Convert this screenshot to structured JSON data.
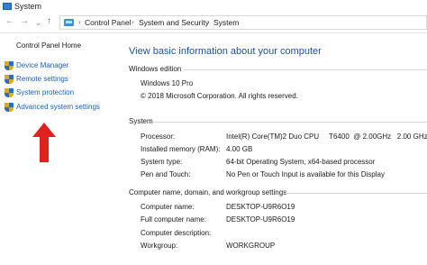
{
  "window": {
    "title": "System"
  },
  "nav": {
    "back_icon": "arrow-left-icon",
    "forward_icon": "arrow-right-icon",
    "up_icon": "arrow-up-icon"
  },
  "breadcrumb": [
    "Control Panel",
    "System and Security",
    "System"
  ],
  "sidebar": {
    "home_label": "Control Panel Home",
    "links": [
      {
        "label": "Device Manager",
        "icon": "shield-icon"
      },
      {
        "label": "Remote settings",
        "icon": "shield-icon"
      },
      {
        "label": "System protection",
        "icon": "shield-icon"
      },
      {
        "label": "Advanced system settings",
        "icon": "shield-icon"
      }
    ],
    "annotation": {
      "icon": "red-arrow-up-icon",
      "color": "#e0211e"
    }
  },
  "main": {
    "heading": "View basic information about your computer",
    "windows_edition": {
      "title": "Windows edition",
      "edition": "Windows 10 Pro",
      "copyright": "© 2018 Microsoft Corporation. All rights reserved."
    },
    "system": {
      "title": "System",
      "rows": [
        {
          "label": "Processor:",
          "value": "Intel(R) Core(TM)2 Duo CPU     T6400  @ 2.00GHz   2.00 GHz"
        },
        {
          "label": "Installed memory (RAM):",
          "value": "4.00 GB"
        },
        {
          "label": "System type:",
          "value": "64-bit Operating System, x64-based processor"
        },
        {
          "label": "Pen and Touch:",
          "value": "No Pen or Touch Input is available for this Display"
        }
      ]
    },
    "computer_name": {
      "title": "Computer name, domain, and workgroup settings",
      "rows": [
        {
          "label": "Computer name:",
          "value": "DESKTOP-U9R6O19"
        },
        {
          "label": "Full computer name:",
          "value": "DESKTOP-U9R6O19"
        },
        {
          "label": "Computer description:",
          "value": ""
        },
        {
          "label": "Workgroup:",
          "value": "WORKGROUP"
        }
      ]
    }
  },
  "colors": {
    "link": "#1a5fb4",
    "heading": "#1c4f9c",
    "arrow": "#e0211e"
  }
}
